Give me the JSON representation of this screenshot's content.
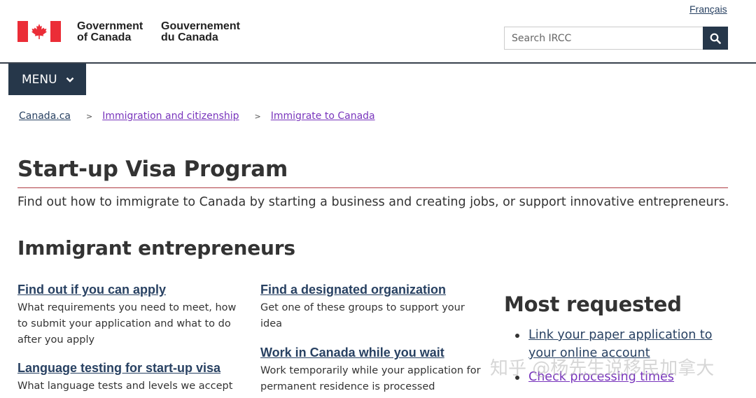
{
  "header": {
    "language_toggle": "Français",
    "signature_en_line1": "Government",
    "signature_en_line2": "of Canada",
    "signature_fr_line1": "Gouvernement",
    "signature_fr_line2": "du Canada",
    "search_placeholder": "Search IRCC",
    "search_icon": "search-icon",
    "menu_label": "MENU",
    "colors": {
      "nav_bg": "#26374a",
      "flag_red": "#eb2d37",
      "link": "#284162",
      "visited_link": "#7834bc",
      "title_rule": "#af3c43"
    }
  },
  "breadcrumb": [
    {
      "label": "Canada.ca"
    },
    {
      "label": "Immigration and citizenship"
    },
    {
      "label": "Immigrate to Canada"
    }
  ],
  "page": {
    "title": "Start-up Visa Program",
    "lead": "Find out how to immigrate to Canada by starting a business and creating jobs, or support innovative entrepreneurs."
  },
  "section": {
    "title": "Immigrant entrepreneurs",
    "cards": [
      {
        "link": "Find out if you can apply",
        "desc": "What requirements you need to meet, how to submit your application and what to do after you apply"
      },
      {
        "link": "Language testing for start-up visa",
        "desc": "What language tests and levels we accept"
      },
      {
        "link": "Find a designated organization",
        "desc": "Get one of these groups to support your idea"
      },
      {
        "link": "Work in Canada while you wait",
        "desc": "Work temporarily while your application for permanent residence is processed"
      }
    ]
  },
  "most_requested": {
    "title": "Most requested",
    "items": [
      {
        "label": "Link your paper application to your online account"
      },
      {
        "label": "Check processing times"
      }
    ]
  },
  "watermark": "知乎 @杨先生说移民加拿大"
}
